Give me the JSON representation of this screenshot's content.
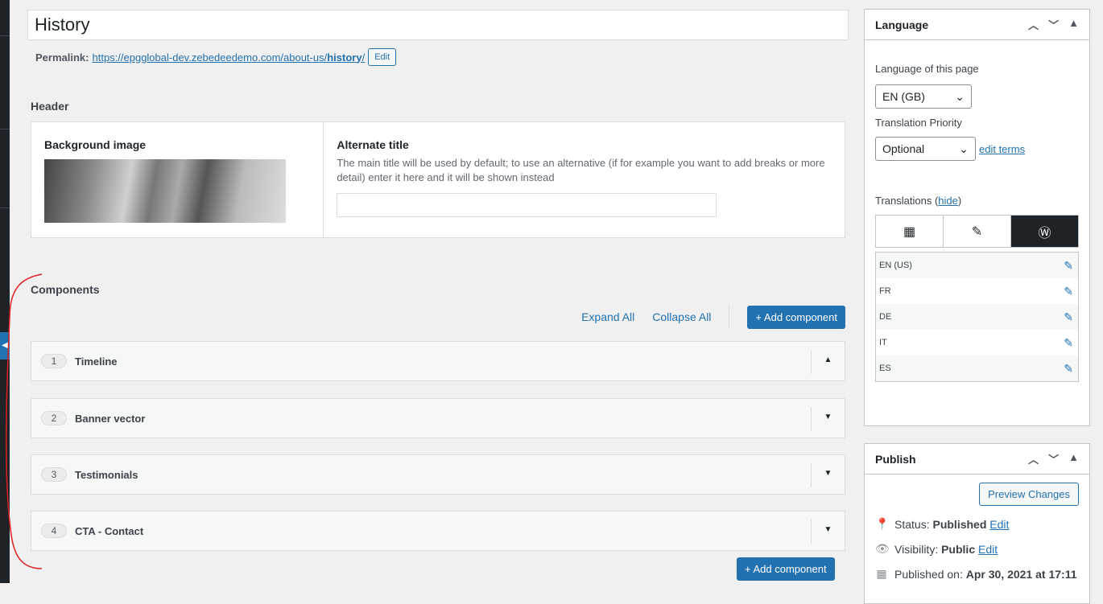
{
  "post": {
    "title": "History",
    "permalink_label": "Permalink:",
    "permalink_base": "https://epgglobal-dev.zebedeedemo.com/about-us/",
    "permalink_slug": "history",
    "permalink_end": "/",
    "edit": "Edit"
  },
  "header": {
    "heading": "Header",
    "bg_label": "Background image",
    "alt_label": "Alternate title",
    "alt_desc": "The main title will be used by default; to use an alternative (if for example you want to add breaks or more detail) enter it here and it will be shown instead",
    "alt_value": ""
  },
  "components": {
    "heading": "Components",
    "expand_all": "Expand All",
    "collapse_all": "Collapse All",
    "add": "Add component",
    "items": [
      {
        "n": "1",
        "name": "Timeline",
        "arrow": "▲"
      },
      {
        "n": "2",
        "name": "Banner vector",
        "arrow": "▼"
      },
      {
        "n": "3",
        "name": "Testimonials",
        "arrow": "▼"
      },
      {
        "n": "4",
        "name": "CTA - Contact",
        "arrow": "▼"
      }
    ]
  },
  "language": {
    "title": "Language",
    "lang_label": "Language of this page",
    "lang_value": "EN (GB)",
    "priority_label": "Translation Priority",
    "priority_value": "Optional",
    "edit_terms": "edit terms",
    "translations_label": "Translations (",
    "hide": "hide",
    "close_paren": ")",
    "translations": [
      "EN (US)",
      "FR",
      "DE",
      "IT",
      "ES"
    ]
  },
  "publish": {
    "title": "Publish",
    "preview": "Preview Changes",
    "status_label": "Status:",
    "status": "Published",
    "visibility_label": "Visibility:",
    "visibility": "Public",
    "edit": "Edit",
    "published_label": "Published on:",
    "published": "Apr 30, 2021 at 17:11"
  }
}
